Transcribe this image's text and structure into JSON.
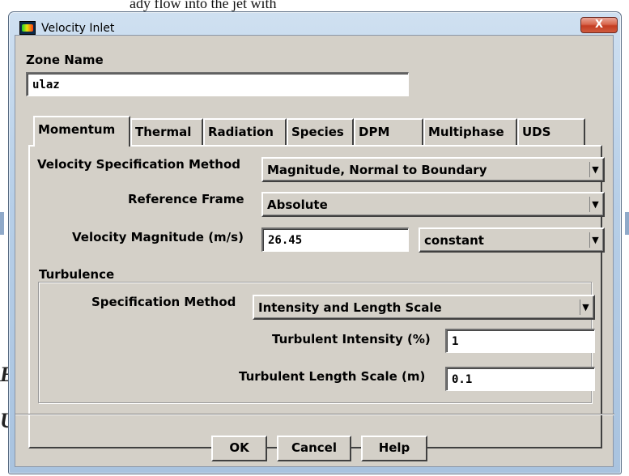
{
  "window": {
    "title": "Velocity Inlet",
    "close_label": "X"
  },
  "zone": {
    "label": "Zone Name",
    "value": "ulaz"
  },
  "tabs": [
    {
      "label": "Momentum",
      "active": true
    },
    {
      "label": "Thermal"
    },
    {
      "label": "Radiation"
    },
    {
      "label": "Species"
    },
    {
      "label": "DPM"
    },
    {
      "label": "Multiphase"
    },
    {
      "label": "UDS"
    }
  ],
  "momentum": {
    "vel_spec_label": "Velocity Specification Method",
    "vel_spec_value": "Magnitude, Normal to Boundary",
    "ref_frame_label": "Reference Frame",
    "ref_frame_value": "Absolute",
    "vel_mag_label": "Velocity Magnitude (m/s)",
    "vel_mag_value": "26.45",
    "vel_mag_profile": "constant"
  },
  "turbulence": {
    "title": "Turbulence",
    "spec_label": "Specification Method",
    "spec_value": "Intensity and Length Scale",
    "intensity_label": "Turbulent Intensity (%)",
    "intensity_value": "1",
    "length_label": "Turbulent Length Scale (m)",
    "length_value": "0.1"
  },
  "buttons": {
    "ok": "OK",
    "cancel": "Cancel",
    "help": "Help"
  },
  "background": {
    "top_text": "ady flow into the jet with",
    "letter_1": "E",
    "letter_2": "U"
  }
}
